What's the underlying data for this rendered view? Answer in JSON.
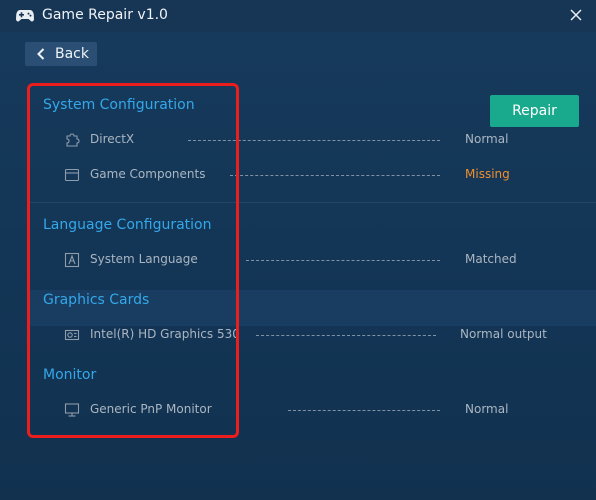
{
  "window": {
    "title": "Game Repair v1.0",
    "close_icon": "close-icon",
    "app_icon": "gamepad-icon"
  },
  "nav": {
    "back_label": "Back"
  },
  "actions": {
    "repair_label": "Repair"
  },
  "colors": {
    "accent": "#34a7ea",
    "repair": "#19a98d",
    "missing": "#ef8f2f",
    "highlight": "#ec1d1d",
    "background": "#16385a"
  },
  "sections": [
    {
      "title": "System Configuration",
      "items": [
        {
          "icon": "puzzle-icon",
          "label": "DirectX",
          "status": "Normal"
        },
        {
          "icon": "window-icon",
          "label": "Game Components",
          "status": "Missing"
        }
      ]
    },
    {
      "title": "Language Configuration",
      "items": [
        {
          "icon": "language-icon",
          "label": "System Language",
          "status": "Matched"
        }
      ]
    },
    {
      "title": "Graphics Cards",
      "items": [
        {
          "icon": "graphics-card-icon",
          "label": "Intel(R) HD Graphics 530",
          "status": "Normal output"
        }
      ]
    },
    {
      "title": "Monitor",
      "items": [
        {
          "icon": "monitor-icon",
          "label": "Generic PnP Monitor",
          "status": "Normal"
        }
      ]
    }
  ]
}
